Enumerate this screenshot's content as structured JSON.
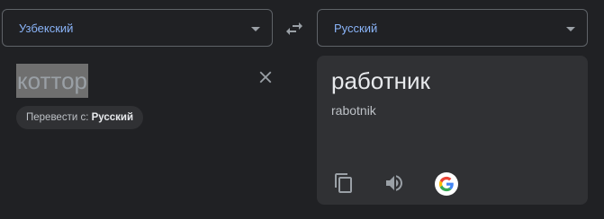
{
  "source_language": {
    "label": "Узбекский"
  },
  "target_language": {
    "label": "Русский"
  },
  "source": {
    "text": "коттор",
    "detect_prefix": "Перевести с: ",
    "detect_language": "Русский"
  },
  "result": {
    "text": "работник",
    "transliteration": "rabotnik"
  },
  "icons": {
    "swap": "swap-icon",
    "clear": "close-icon",
    "copy": "copy-icon",
    "speak": "speaker-icon",
    "google": "google-logo-icon",
    "dropdown": "chevron-down-icon"
  },
  "colors": {
    "background": "#202124",
    "card": "#303134",
    "accent": "#8ab4f8",
    "text": "#e8eaed",
    "muted": "#9aa0a6"
  }
}
